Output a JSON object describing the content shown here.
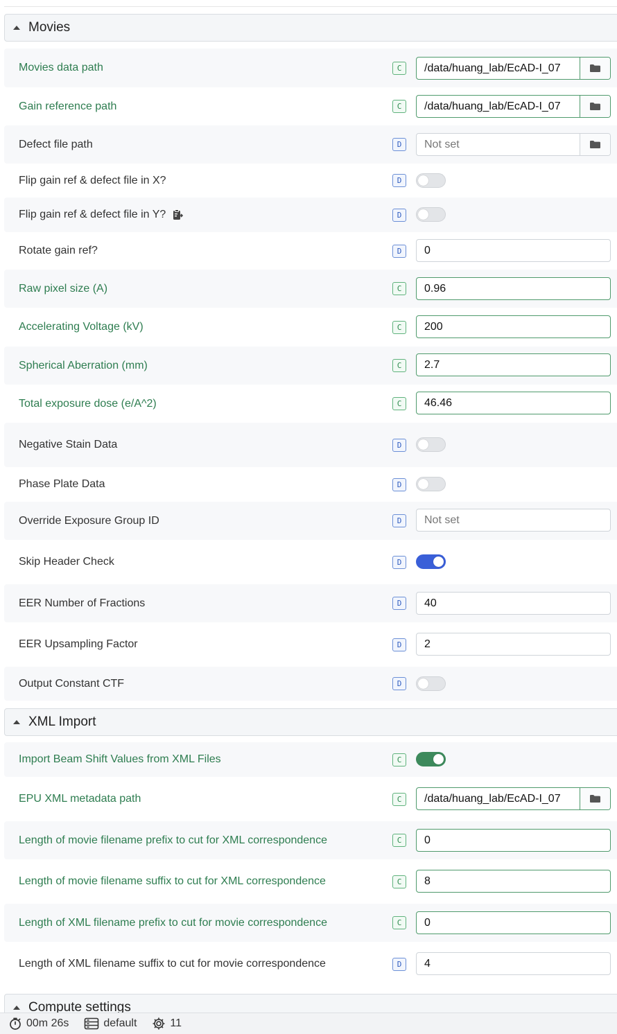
{
  "sections": {
    "movies": {
      "title": "Movies"
    },
    "xml_import": {
      "title": "XML Import"
    },
    "compute": {
      "title": "Compute settings"
    }
  },
  "badges": {
    "changed": "C",
    "default": "D"
  },
  "movies": {
    "movies_data_path": {
      "label": "Movies data path",
      "value": "/data/huang_lab/EcAD-I_07",
      "badge": "C"
    },
    "gain_reference_path": {
      "label": "Gain reference path",
      "value": "/data/huang_lab/EcAD-I_07",
      "badge": "C"
    },
    "defect_file_path": {
      "label": "Defect file path",
      "placeholder": "Not set",
      "badge": "D"
    },
    "flip_x": {
      "label": "Flip gain ref & defect file in X?",
      "on": false,
      "badge": "D"
    },
    "flip_y": {
      "label": "Flip gain ref & defect file in Y?",
      "on": false,
      "badge": "D"
    },
    "rotate_gain": {
      "label": "Rotate gain ref?",
      "value": "0",
      "badge": "D"
    },
    "raw_pixel_size": {
      "label": "Raw pixel size (A)",
      "value": "0.96",
      "badge": "C"
    },
    "voltage": {
      "label": "Accelerating Voltage (kV)",
      "value": "200",
      "badge": "C"
    },
    "spherical_aberration": {
      "label": "Spherical Aberration (mm)",
      "value": "2.7",
      "badge": "C"
    },
    "exposure_dose": {
      "label": "Total exposure dose (e/A^2)",
      "value": "46.46",
      "badge": "C"
    },
    "negative_stain": {
      "label": "Negative Stain Data",
      "on": false,
      "badge": "D"
    },
    "phase_plate": {
      "label": "Phase Plate Data",
      "on": false,
      "badge": "D"
    },
    "override_exposure_group": {
      "label": "Override Exposure Group ID",
      "placeholder": "Not set",
      "badge": "D"
    },
    "skip_header_check": {
      "label": "Skip Header Check",
      "on": true,
      "badge": "D"
    },
    "eer_fractions": {
      "label": "EER Number of Fractions",
      "value": "40",
      "badge": "D"
    },
    "eer_upsampling": {
      "label": "EER Upsampling Factor",
      "value": "2",
      "badge": "D"
    },
    "output_constant_ctf": {
      "label": "Output Constant CTF",
      "on": false,
      "badge": "D"
    }
  },
  "xml_import": {
    "import_beam_shift": {
      "label": "Import Beam Shift Values from XML Files",
      "on": true,
      "badge": "C"
    },
    "epu_xml_path": {
      "label": "EPU XML metadata path",
      "value": "/data/huang_lab/EcAD-I_07",
      "badge": "C"
    },
    "movie_prefix_cut": {
      "label": "Length of movie filename prefix to cut for XML correspondence",
      "value": "0",
      "badge": "C"
    },
    "movie_suffix_cut": {
      "label": "Length of movie filename suffix to cut for XML correspondence",
      "value": "8",
      "badge": "C"
    },
    "xml_prefix_cut": {
      "label": "Length of XML filename prefix to cut for movie correspondence",
      "value": "0",
      "badge": "C"
    },
    "xml_suffix_cut": {
      "label": "Length of XML filename suffix to cut for movie correspondence",
      "value": "4",
      "badge": "D"
    }
  },
  "statusbar": {
    "elapsed": "00m 26s",
    "profile": "default",
    "jobs": "11"
  },
  "icons": {
    "folder": "folder-icon",
    "clipboard": "clipboard-icon",
    "timer": "timer-icon",
    "server": "server-icon",
    "gear": "gear-icon"
  },
  "colors": {
    "changed_green": "#2e7d50",
    "default_blue": "#2f5cbf",
    "toggle_blue": "#3a5fd8",
    "toggle_green": "#3d8a5c"
  }
}
